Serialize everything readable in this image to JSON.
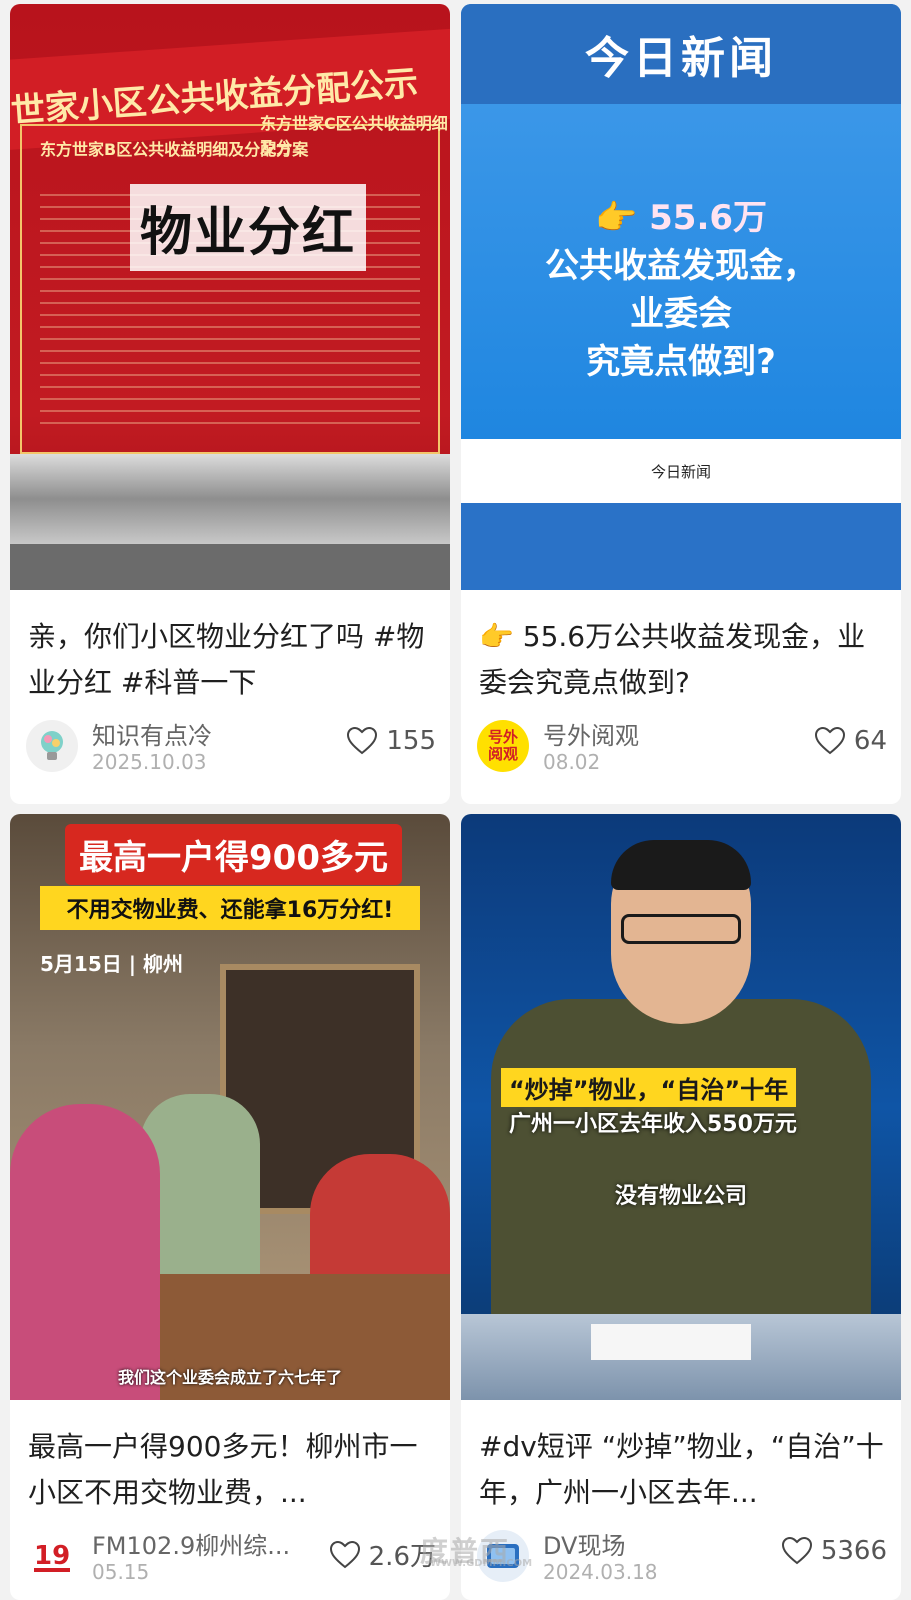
{
  "cards": [
    {
      "thumb": {
        "banner": "世家小区公共收益分配公示",
        "sub_left": "东方世家B区公共收益明细及分配方案",
        "sub_right": "东方世家C区公共收益明细及分",
        "overlay": "物业分红"
      },
      "title": "亲，你们小区物业分红了吗 #物业分红 #科普一下",
      "author": "知识有点冷",
      "date": "2025.10.03",
      "likes": "155"
    },
    {
      "thumb": {
        "header": "今日新闻",
        "line1": "👉 55.6万",
        "line2": "公共收益发现金，",
        "line3": "业委会",
        "line4": "究竟点做到?",
        "footer": "今日新闻"
      },
      "title": "👉 55.6万公共收益发现金，业委会究竟点做到?",
      "author": "号外阅观",
      "avatar_text": "号外阅观",
      "date": "08.02",
      "likes": "64"
    },
    {
      "thumb": {
        "headline": "最高一户得900多元",
        "subline": "不用交物业费、还能拿16万分红!",
        "date_place": "5月15日 | 柳州",
        "caption": "我们这个业委会成立了六七年了"
      },
      "title": "最高一户得900多元！柳州市一小区不用交物业费，...",
      "author": "FM102.9柳州综...",
      "date": "05.15",
      "likes": "2.6万"
    },
    {
      "thumb": {
        "caption1": "“炒掉”物业，“自治”十年",
        "caption2": "广州一小区去年收入550万元",
        "caption3": "没有物业公司"
      },
      "title": "#dv短评 “炒掉”物业，“自治”十年，广州一小区去年...",
      "author": "DV现场",
      "date": "2024.03.18",
      "likes": "5366"
    }
  ],
  "watermark": {
    "text": "度普西",
    "url": "WWW.GDMM.COM"
  },
  "colors": {
    "background": "#f2f2f2",
    "card": "#ffffff",
    "accent_red": "#d21e25",
    "accent_yellow": "#ffd61f"
  }
}
